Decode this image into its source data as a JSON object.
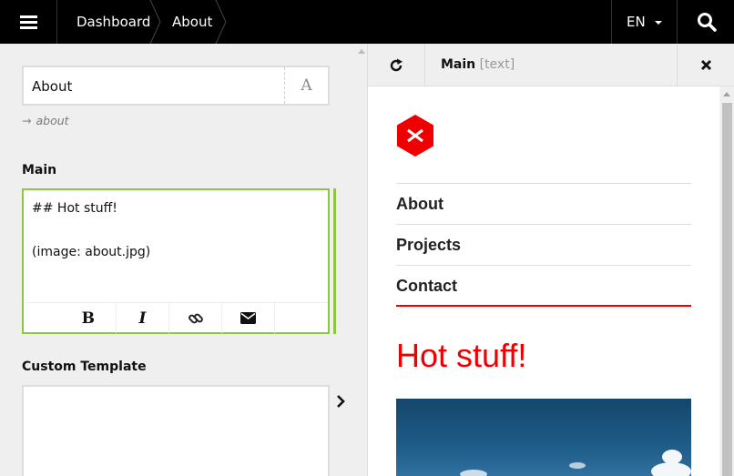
{
  "topbar": {
    "breadcrumb": [
      "Dashboard",
      "About"
    ],
    "language": "EN"
  },
  "editor": {
    "title_value": "About",
    "slug": "about",
    "main_label": "Main",
    "main_text": [
      "## Hot stuff!",
      "",
      "(image: about.jpg)"
    ],
    "toolbar": [
      "bold",
      "italic",
      "link",
      "email"
    ],
    "custom_template_label": "Custom Template",
    "focus_color": "#8dc63f"
  },
  "preview": {
    "field_name": "Main",
    "field_type": "[text]",
    "nav": [
      "About",
      "Projects",
      "Contact"
    ],
    "headline": "Hot stuff!",
    "accent_color": "#ee0000"
  }
}
